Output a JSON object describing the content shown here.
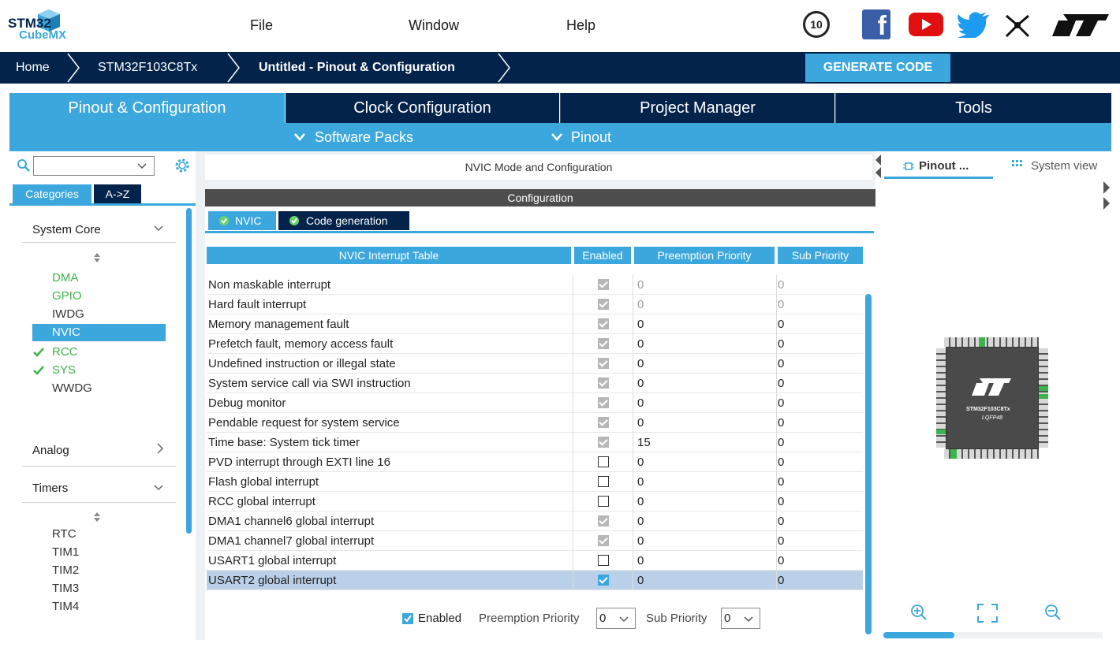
{
  "app": {
    "logo_top": "STM32",
    "logo_bottom": "CubeMX"
  },
  "menu": {
    "file": "File",
    "window": "Window",
    "help": "Help"
  },
  "badge": {
    "anniversary": "10"
  },
  "breadcrumb": {
    "home": "Home",
    "mcu": "STM32F103C8Tx",
    "current": "Untitled - Pinout & Configuration"
  },
  "generate_label": "GENERATE CODE",
  "main_tabs": {
    "pinout": "Pinout & Configuration",
    "clock": "Clock Configuration",
    "project": "Project Manager",
    "tools": "Tools"
  },
  "subbar": {
    "software_packs": "Software Packs",
    "pinout": "Pinout"
  },
  "left": {
    "tabs": {
      "categories": "Categories",
      "az": "A->Z"
    },
    "system_core": "System Core",
    "system_core_items": [
      {
        "label": "DMA",
        "state": "green"
      },
      {
        "label": "GPIO",
        "state": "green"
      },
      {
        "label": "IWDG",
        "state": "normal"
      },
      {
        "label": "NVIC",
        "state": "selected"
      },
      {
        "label": "RCC",
        "state": "check"
      },
      {
        "label": "SYS",
        "state": "check"
      },
      {
        "label": "WWDG",
        "state": "normal"
      }
    ],
    "analog": "Analog",
    "timers": "Timers",
    "timers_items": [
      "RTC",
      "TIM1",
      "TIM2",
      "TIM3",
      "TIM4"
    ]
  },
  "center": {
    "title": "NVIC Mode and Configuration",
    "config_header": "Configuration",
    "tab_nvic": "NVIC",
    "tab_codegen": "Code generation",
    "table_headers": {
      "name": "NVIC Interrupt Table",
      "enabled": "Enabled",
      "preemption": "Preemption Priority",
      "sub": "Sub Priority"
    },
    "rows": [
      {
        "name": "Non maskable interrupt",
        "enabled": true,
        "locked": true,
        "preemption": "0",
        "sub": "0",
        "dim": true
      },
      {
        "name": "Hard fault interrupt",
        "enabled": true,
        "locked": true,
        "preemption": "0",
        "sub": "0",
        "dim": true
      },
      {
        "name": "Memory management fault",
        "enabled": true,
        "locked": true,
        "preemption": "0",
        "sub": "0",
        "dim": false
      },
      {
        "name": "Prefetch fault, memory access fault",
        "enabled": true,
        "locked": true,
        "preemption": "0",
        "sub": "0",
        "dim": false
      },
      {
        "name": "Undefined instruction or illegal state",
        "enabled": true,
        "locked": true,
        "preemption": "0",
        "sub": "0",
        "dim": false
      },
      {
        "name": "System service call via SWI instruction",
        "enabled": true,
        "locked": true,
        "preemption": "0",
        "sub": "0",
        "dim": false
      },
      {
        "name": "Debug monitor",
        "enabled": true,
        "locked": true,
        "preemption": "0",
        "sub": "0",
        "dim": false
      },
      {
        "name": "Pendable request for system service",
        "enabled": true,
        "locked": true,
        "preemption": "0",
        "sub": "0",
        "dim": false
      },
      {
        "name": "Time base: System tick timer",
        "enabled": true,
        "locked": true,
        "preemption": "15",
        "sub": "0",
        "dim": false
      },
      {
        "name": "PVD interrupt through EXTI line 16",
        "enabled": false,
        "locked": false,
        "preemption": "0",
        "sub": "0",
        "dim": false
      },
      {
        "name": "Flash global interrupt",
        "enabled": false,
        "locked": false,
        "preemption": "0",
        "sub": "0",
        "dim": false
      },
      {
        "name": "RCC global interrupt",
        "enabled": false,
        "locked": false,
        "preemption": "0",
        "sub": "0",
        "dim": false
      },
      {
        "name": "DMA1 channel6 global interrupt",
        "enabled": true,
        "locked": true,
        "preemption": "0",
        "sub": "0",
        "dim": false
      },
      {
        "name": "DMA1 channel7 global interrupt",
        "enabled": true,
        "locked": true,
        "preemption": "0",
        "sub": "0",
        "dim": false
      },
      {
        "name": "USART1 global interrupt",
        "enabled": false,
        "locked": false,
        "preemption": "0",
        "sub": "0",
        "dim": false
      },
      {
        "name": "USART2 global interrupt",
        "enabled": true,
        "locked": false,
        "preemption": "0",
        "sub": "0",
        "dim": false,
        "selected": true
      }
    ],
    "footer": {
      "enabled_label": "Enabled",
      "preemption_label": "Preemption Priority",
      "preemption_value": "0",
      "sub_label": "Sub Priority",
      "sub_value": "0"
    }
  },
  "right": {
    "tab_pinout": "Pinout ...",
    "tab_system": "System view",
    "chip_name": "STM32F103C8Tx",
    "chip_package": "LQFP48"
  },
  "colors": {
    "navy": "#03234b",
    "accent": "#3ca7dc",
    "green": "#3cb44b",
    "selected_row": "#b9d0e8"
  }
}
